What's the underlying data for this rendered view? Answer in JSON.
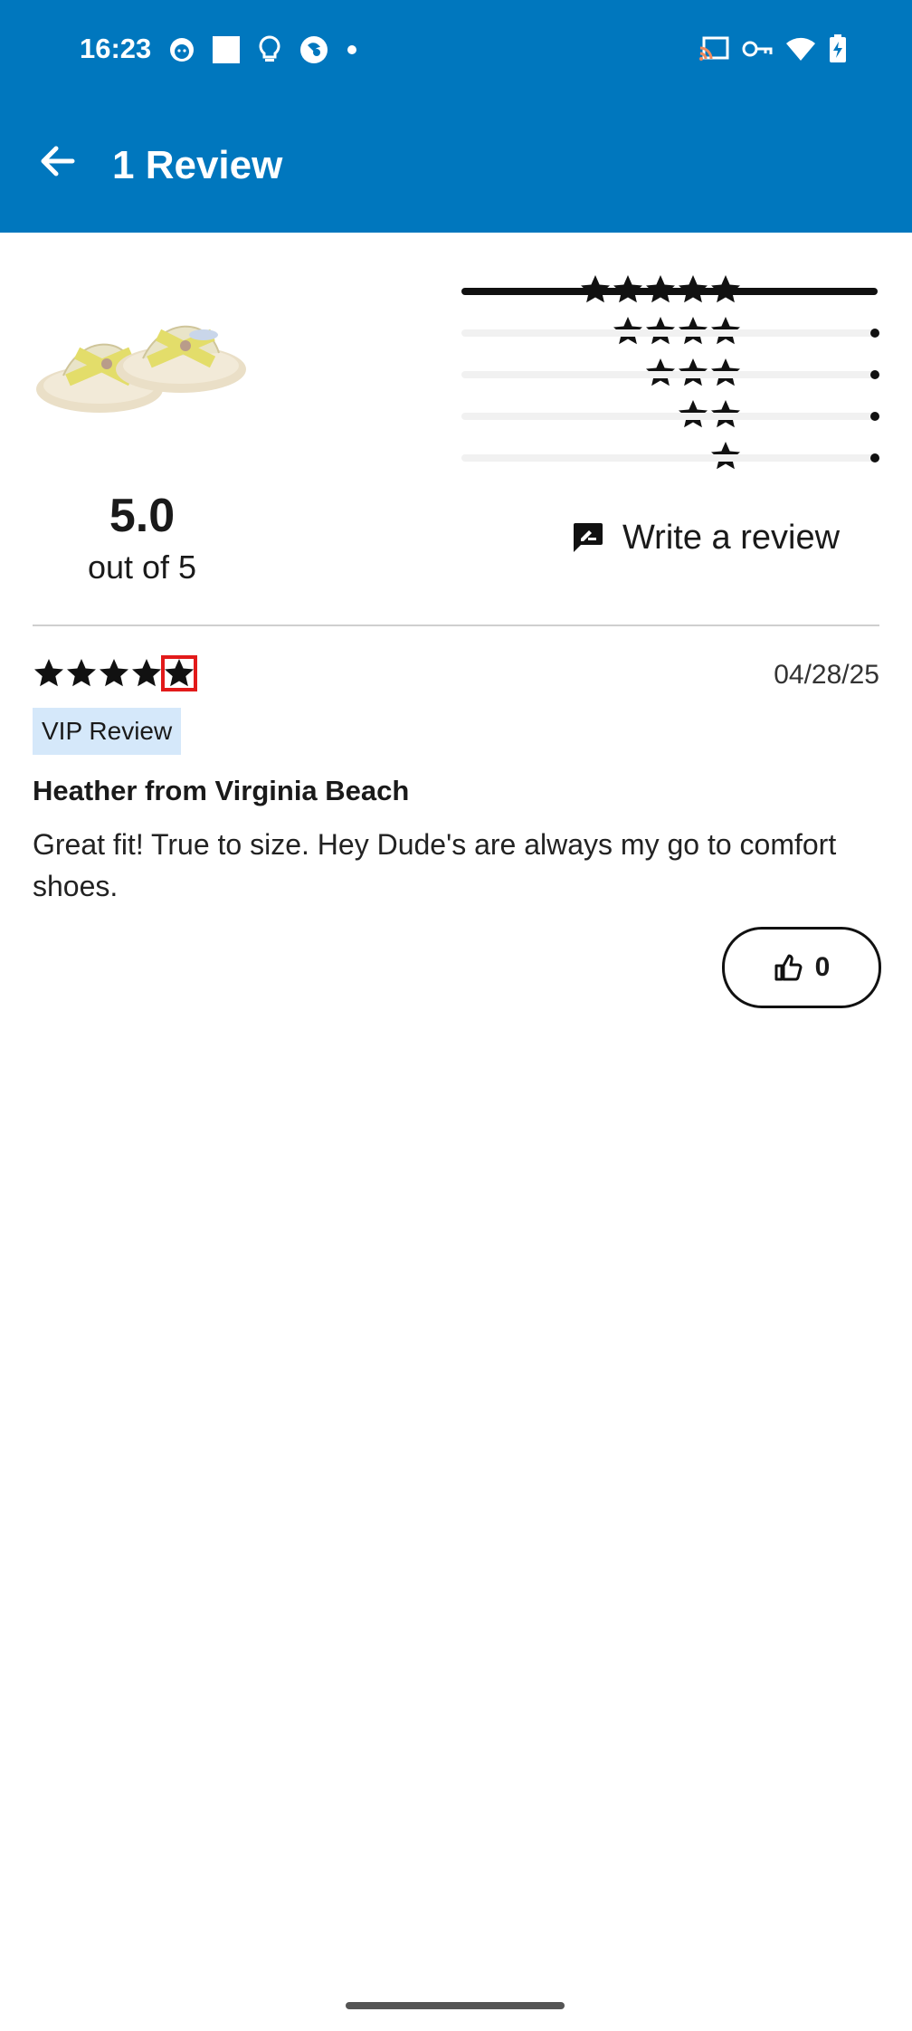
{
  "status_bar": {
    "time": "16:23",
    "left_icons": [
      "app-face-icon",
      "square-icon",
      "bulb-icon",
      "globe-icon",
      "dot-icon"
    ],
    "right_icons": [
      "cast-icon",
      "vpn-key-icon",
      "wifi-icon",
      "battery-charging-icon"
    ]
  },
  "app_bar": {
    "title": "1 Review",
    "back_icon": "arrow-left-icon"
  },
  "summary": {
    "average": "5.0",
    "out_of": "out of 5",
    "histogram": [
      {
        "stars": 5,
        "fraction": 1.0
      },
      {
        "stars": 4,
        "fraction": 0.0
      },
      {
        "stars": 3,
        "fraction": 0.0
      },
      {
        "stars": 2,
        "fraction": 0.0
      },
      {
        "stars": 1,
        "fraction": 0.0
      }
    ]
  },
  "write_review": {
    "label": "Write a review",
    "icon": "rate-review-icon"
  },
  "review": {
    "rating": 5,
    "date": "04/28/25",
    "badge": "VIP Review",
    "author": "Heather from Virginia Beach",
    "text": "Great fit! True to size.  Hey Dude's are always my go to comfort shoes.",
    "helpful_count": "0",
    "helpful_icon": "thumb-up-icon"
  },
  "colors": {
    "app_bar": "#0077be",
    "vip_badge_bg": "#d5e8fa",
    "highlight": "#e21a1a"
  }
}
